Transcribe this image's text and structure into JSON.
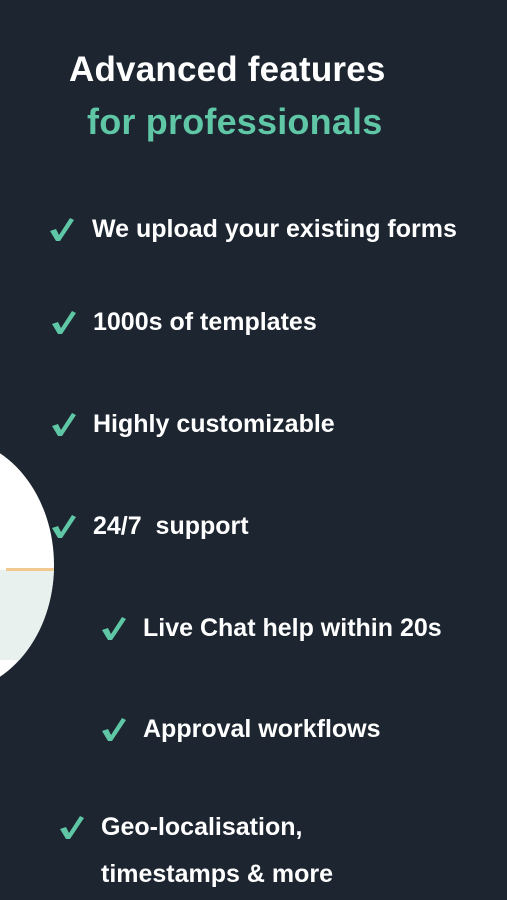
{
  "heading": {
    "line1": "Advanced features",
    "line2": "for professionals"
  },
  "features": [
    {
      "label": "We upload your existing forms"
    },
    {
      "label": "1000s of templates"
    },
    {
      "label": "Highly customizable"
    },
    {
      "label": "24/7  support"
    },
    {
      "label": "Live Chat help within 20s"
    },
    {
      "label": "Approval workflows"
    },
    {
      "label_line1": "Geo-localisation,",
      "label_line2": "timestamps & more"
    }
  ],
  "colors": {
    "background": "#1c2530",
    "accent": "#5fc7a6",
    "text": "#ffffff"
  },
  "icons": {
    "check": "check-icon"
  }
}
